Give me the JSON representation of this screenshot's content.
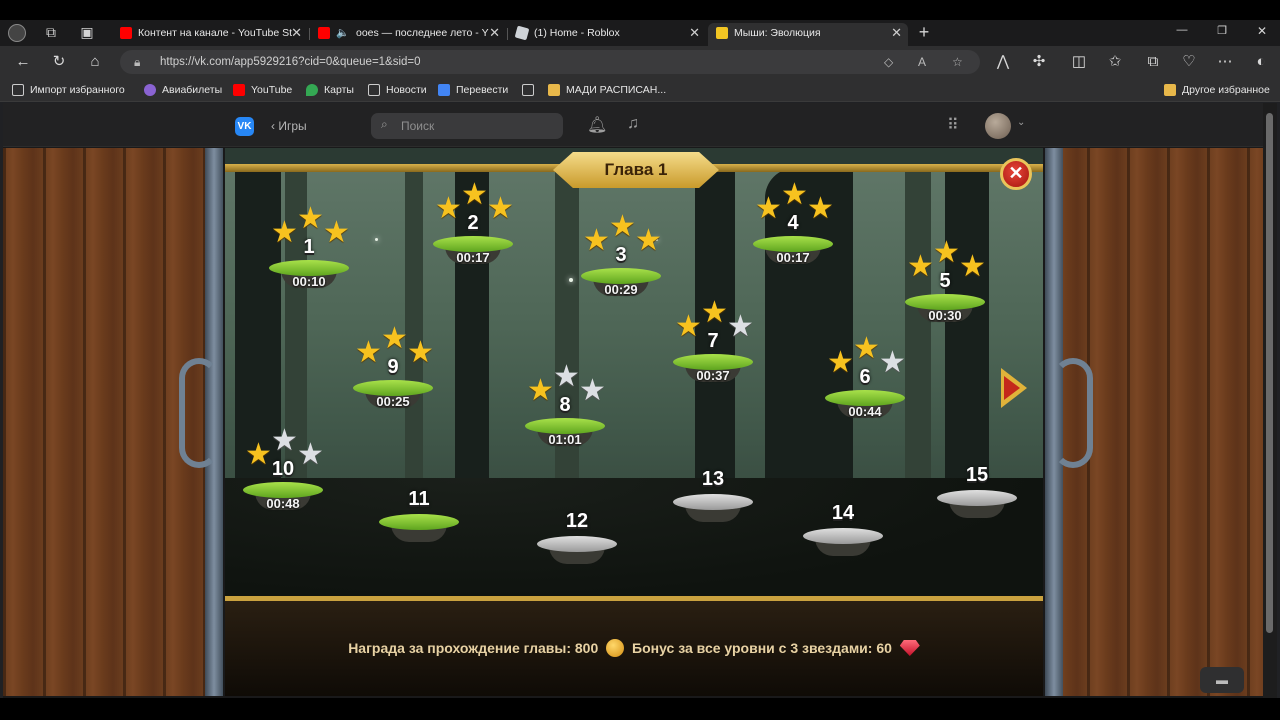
{
  "tabs": [
    {
      "label": "Контент на канале - YouTube St",
      "icon": "youtube-icon",
      "active": false
    },
    {
      "label": "ooes — последнее лето - Y",
      "icon": "youtube-icon",
      "active": false
    },
    {
      "label": "(1) Home - Roblox",
      "icon": "roblox-icon",
      "active": false
    },
    {
      "label": "Мыши: Эволюция",
      "icon": "game-icon",
      "active": true
    }
  ],
  "new_tab": "+",
  "window_controls": {
    "minimize": "—",
    "maximize": "❐",
    "close": "✕"
  },
  "address": {
    "url": "https://vk.com/app5929216?cid=0&queue=1&sid=0"
  },
  "bookmarks": [
    {
      "label": "Импорт избранного",
      "icon": "import-icon"
    },
    {
      "label": "Авиабилеты",
      "icon": "plane-icon"
    },
    {
      "label": "YouTube",
      "icon": "youtube-icon"
    },
    {
      "label": "Карты",
      "icon": "map-icon"
    },
    {
      "label": "Новости",
      "icon": "news-icon"
    },
    {
      "label": "Перевести",
      "icon": "translate-icon"
    },
    {
      "label": "МАДИ РАСПИСАН...",
      "icon": "folder-icon"
    }
  ],
  "other_bookmarks": "Другое избранное",
  "vk": {
    "logo": "VK",
    "back_label": "Игры",
    "search_placeholder": "Поиск"
  },
  "game": {
    "chapter_title": "Глава 1",
    "close": "✕",
    "levels": [
      {
        "num": "1",
        "time": "00:10",
        "stars": 3,
        "type": "green"
      },
      {
        "num": "2",
        "time": "00:17",
        "stars": 3,
        "type": "green"
      },
      {
        "num": "3",
        "time": "00:29",
        "stars": 3,
        "type": "green"
      },
      {
        "num": "4",
        "time": "00:17",
        "stars": 3,
        "type": "green"
      },
      {
        "num": "5",
        "time": "00:30",
        "stars": 3,
        "type": "green"
      },
      {
        "num": "6",
        "time": "00:44",
        "stars": 2,
        "type": "green"
      },
      {
        "num": "7",
        "time": "00:37",
        "stars": 2,
        "type": "green"
      },
      {
        "num": "8",
        "time": "01:01",
        "stars": 1,
        "type": "green"
      },
      {
        "num": "9",
        "time": "00:25",
        "stars": 3,
        "type": "green"
      },
      {
        "num": "10",
        "time": "00:48",
        "stars": 1,
        "type": "green"
      },
      {
        "num": "11",
        "time": "",
        "stars": 0,
        "type": "green"
      },
      {
        "num": "12",
        "time": "",
        "stars": 0,
        "type": "grey"
      },
      {
        "num": "13",
        "time": "",
        "stars": 0,
        "type": "grey"
      },
      {
        "num": "14",
        "time": "",
        "stars": 0,
        "type": "grey"
      },
      {
        "num": "15",
        "time": "",
        "stars": 0,
        "type": "grey"
      }
    ],
    "reward_text": "Награда за прохождение главы: 800",
    "bonus_text": "Бонус за все уровни с 3 звездами: 60"
  }
}
